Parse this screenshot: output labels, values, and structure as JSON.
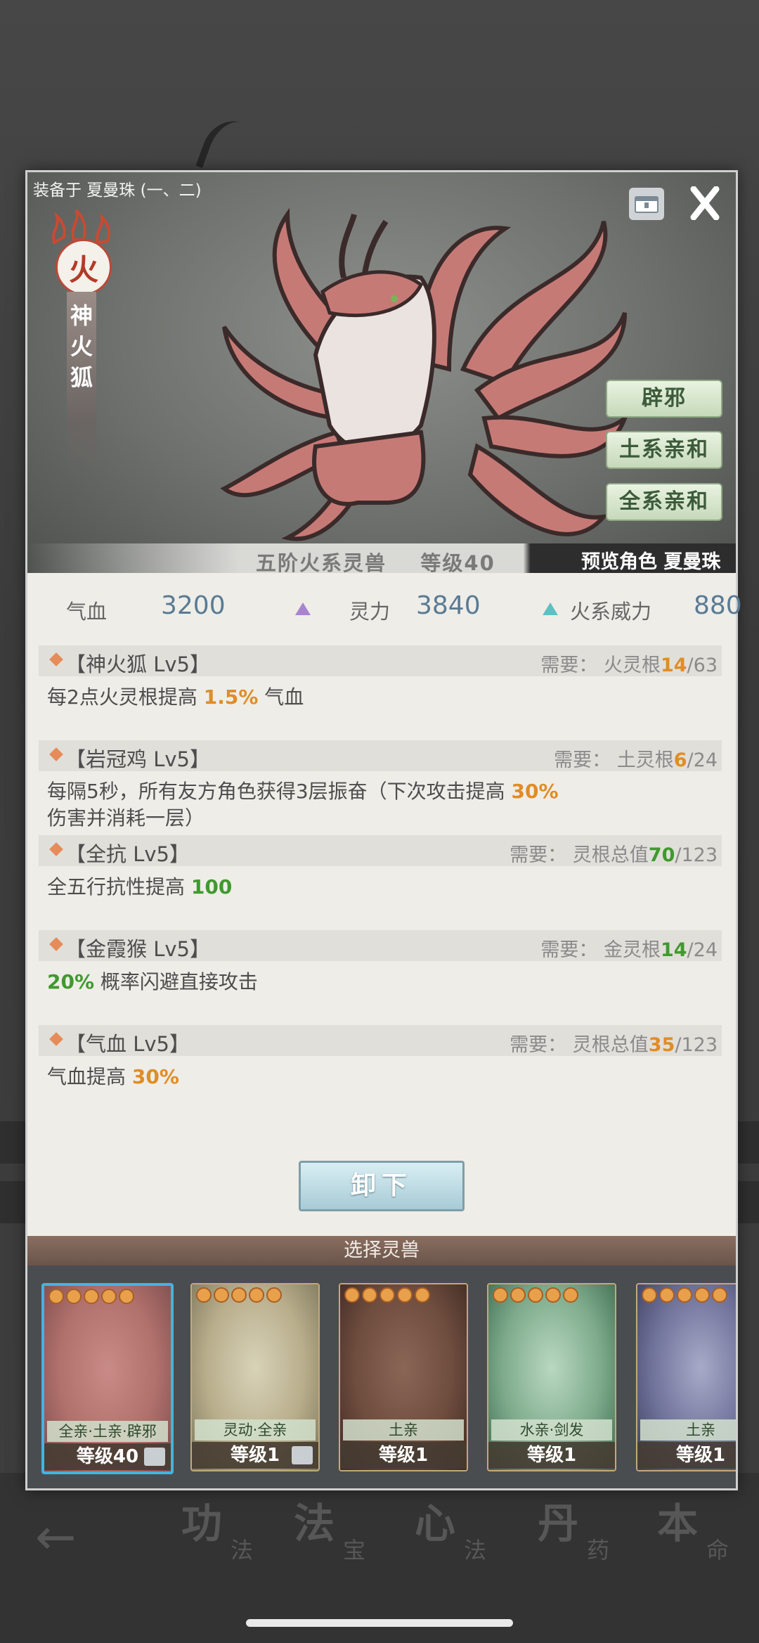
{
  "background": {
    "nav": [
      {
        "big": "功",
        "small": "法"
      },
      {
        "big": "法",
        "small": "宝"
      },
      {
        "big": "心",
        "small": "法"
      },
      {
        "big": "丹",
        "small": "药"
      },
      {
        "big": "本",
        "small": "命"
      }
    ]
  },
  "hero": {
    "equipped_on": "装备于 夏曼珠 (一、二)",
    "element_badge": "火",
    "beast_name_chars": [
      "神",
      "火",
      "狐"
    ],
    "traits": [
      "辟邪",
      "土系亲和",
      "全系亲和"
    ],
    "tier": "五阶火系灵兽",
    "level": "等级40",
    "preview_character": "预览角色 夏曼珠"
  },
  "stats": [
    {
      "label": "气血",
      "value": "3200",
      "icon_color": ""
    },
    {
      "label": "灵力",
      "value": "3840",
      "icon_color": "#a884d0"
    },
    {
      "label": "火系威力",
      "value": "880",
      "icon_color": "#5cc1c4"
    }
  ],
  "skills": [
    {
      "title": "【神火狐 Lv5】",
      "req_prefix": "需要：  火灵根",
      "req_current": "14",
      "req_total": "/63",
      "req_color": "orange",
      "desc_pre": "每2点火灵根提高 ",
      "desc_hl": "1.5%",
      "desc_post": " 气血",
      "desc_hl_color": "orange"
    },
    {
      "title": "【岩冠鸡 Lv5】",
      "req_prefix": "需要：  土灵根",
      "req_current": "6",
      "req_total": "/24",
      "req_color": "orange",
      "desc_pre": "每隔5秒，所有友方角色获得3层振奋（下次攻击提高 ",
      "desc_hl": "30%",
      "desc_post": " 伤害并消耗一层）",
      "desc_hl_color": "orange"
    },
    {
      "title": "【全抗 Lv5】",
      "req_prefix": "需要：  灵根总值",
      "req_current": "70",
      "req_total": "/123",
      "req_color": "green",
      "desc_pre": "全五行抗性提高 ",
      "desc_hl": "100",
      "desc_post": "",
      "desc_hl_color": "green"
    },
    {
      "title": "【金霞猴 Lv5】",
      "req_prefix": "需要：  金灵根",
      "req_current": "14",
      "req_total": "/24",
      "req_color": "green",
      "desc_pre": "",
      "desc_hl": "20%",
      "desc_post": " 概率闪避直接攻击",
      "desc_hl_color": "green"
    },
    {
      "title": "【气血 Lv5】",
      "req_prefix": "需要：  灵根总值",
      "req_current": "35",
      "req_total": "/123",
      "req_color": "orange",
      "desc_pre": "气血提高 ",
      "desc_hl": "30%",
      "desc_post": "",
      "desc_hl_color": "orange"
    }
  ],
  "unequip_label": "卸下",
  "select_title": "选择灵兽",
  "cards": [
    {
      "tag": "全亲·土亲·辟邪",
      "level": "等级40",
      "selected": true,
      "stars": 5,
      "palette": [
        "#c98b87",
        "#b0706c",
        "#7a4c4a"
      ]
    },
    {
      "tag": "灵动·全亲",
      "level": "等级1",
      "selected": false,
      "stars": 5,
      "palette": [
        "#d8d2b8",
        "#b8ae8c",
        "#7c755a"
      ]
    },
    {
      "tag": "土亲",
      "level": "等级1",
      "selected": false,
      "stars": 5,
      "palette": [
        "#8a6656",
        "#6e4c3e",
        "#3e2a22"
      ]
    },
    {
      "tag": "水亲·剑发",
      "level": "等级1",
      "selected": false,
      "stars": 5,
      "palette": [
        "#b9d8c1",
        "#7eab8b",
        "#3d6a50"
      ]
    },
    {
      "tag": "土亲",
      "level": "等级1",
      "selected": false,
      "stars": 5,
      "palette": [
        "#a8aac8",
        "#6f729a",
        "#3c3e5c"
      ]
    }
  ]
}
